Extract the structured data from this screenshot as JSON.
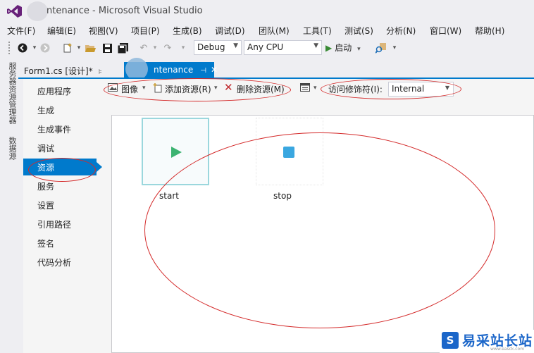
{
  "window": {
    "title": "ntenance - Microsoft Visual Studio"
  },
  "menu": [
    {
      "label": "文件(F)"
    },
    {
      "label": "编辑(E)"
    },
    {
      "label": "视图(V)"
    },
    {
      "label": "项目(P)"
    },
    {
      "label": "生成(B)"
    },
    {
      "label": "调试(D)"
    },
    {
      "label": "团队(M)"
    },
    {
      "label": "工具(T)"
    },
    {
      "label": "测试(S)"
    },
    {
      "label": "分析(N)"
    },
    {
      "label": "窗口(W)"
    },
    {
      "label": "帮助(H)"
    }
  ],
  "toolbar": {
    "configuration": "Debug",
    "platform": "Any CPU",
    "start_label": "启动"
  },
  "side_panels": [
    "服务器资源管理器",
    "数据源"
  ],
  "tabs": [
    {
      "label": "Form1.cs [设计]*",
      "pin": "⊧"
    },
    {
      "label": "ntenance",
      "pin": "⊣",
      "close": "✕"
    }
  ],
  "nav": [
    {
      "label": "应用程序"
    },
    {
      "label": "生成"
    },
    {
      "label": "生成事件"
    },
    {
      "label": "调试"
    },
    {
      "label": "资源"
    },
    {
      "label": "服务"
    },
    {
      "label": "设置"
    },
    {
      "label": "引用路径"
    },
    {
      "label": "签名"
    },
    {
      "label": "代码分析"
    }
  ],
  "resource_toolbar": {
    "image_label": "图像",
    "add_resource_label": "添加资源(R)",
    "remove_resource_label": "删除资源(M)",
    "access_modifier_label": "访问修饰符(I):",
    "access_modifier_value": "Internal"
  },
  "resources": [
    {
      "name": "start",
      "icon": "play-triangle-icon",
      "color": "#3cb371"
    },
    {
      "name": "stop",
      "icon": "stop-square-icon",
      "color": "#3aa7e0"
    }
  ],
  "watermark": {
    "logo_char": "S",
    "text": "易采站长站",
    "small": "www.easck.com"
  }
}
